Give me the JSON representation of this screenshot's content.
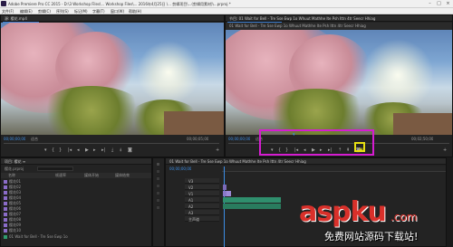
{
  "app": {
    "title": "Adobe Premiere Pro CC 2015 - D:\\3 Workshop Files\\... Workshop Files\\... 2016年4月25日 \\... 剪辑项目\\...(剪辑用素材)\\...prproj *"
  },
  "menu": [
    "文件(F)",
    "编辑(E)",
    "剪辑(C)",
    "序列(S)",
    "标记(M)",
    "字幕(T)",
    "窗口(W)",
    "帮助(H)"
  ],
  "source_monitor": {
    "tab_label": "源: 樱花.mp4",
    "timecode_left": "00;00;00;00",
    "fit_label": "适合",
    "timecode_right": "00;00;05;00"
  },
  "program_monitor": {
    "tab_label": "节目: 01 Wait for Bell - Tre Sse Ewp 1o Whuut Mathhe Ite Psh Ittn 4tr Seecr Hhiag",
    "timecode_left": "00;00;00;00",
    "fit_label": "适合",
    "timecode_right": "00;02;50;00"
  },
  "project_panel": {
    "tab_label": "项目: 樱花 ≡",
    "info": "樱花.prproj",
    "columns": [
      "名称",
      "帧速率",
      "媒体开始",
      "媒体结束"
    ],
    "items": [
      "樱花01",
      "樱花02",
      "樱花03",
      "樱花04",
      "樱花05",
      "樱花06",
      "樱花07",
      "樱花08",
      "樱花09",
      "樱花10"
    ],
    "footer_item": "01 Wait for Bell - Tre Sse Ewp 1o"
  },
  "timeline": {
    "tab_label": "01 Wait for Bell - Tre Sse Ewp 1o Whuut Mathhe Ite Psh Ittn 4tr Seecr Hhiag",
    "timecode": "00;00;00;00",
    "tracks": [
      "V3",
      "V2",
      "V1",
      "A1",
      "A2",
      "A3",
      "主声道"
    ]
  },
  "watermark": {
    "brand": "aspku",
    "suffix": ".com",
    "tagline": "免费网站源码下载站!"
  },
  "colors": {
    "highlight_magenta": "#d61cd1",
    "highlight_yellow": "#e8e012",
    "timecode_blue": "#3c8ee6",
    "watermark_red": "#d9302a"
  }
}
